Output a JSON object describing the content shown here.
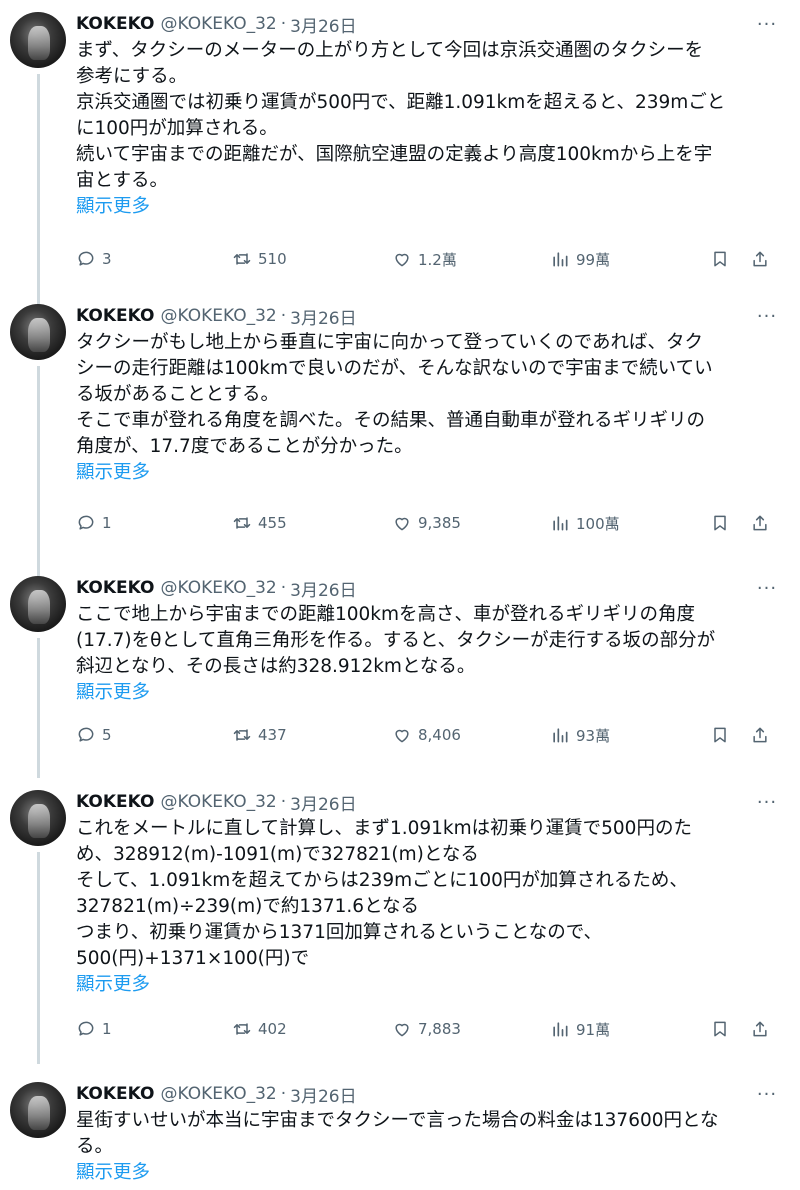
{
  "tweets": [
    {
      "author": {
        "name": "KOKEKO",
        "handle": "@KOKEKO_32",
        "date": "3月26日"
      },
      "lines": [
        "まず、タクシーのメーターの上がり方として今回は京浜交通圏のタクシーを",
        "参考にする。",
        "京浜交通圏では初乗り運賃が500円で、距離1.091kmを超えると、239mごと",
        "に100円が加算される。",
        "続いて宇宙までの距離だが、国際航空連盟の定義より高度100kmから上を宇",
        "宙とする。"
      ],
      "show_more": "顯示更多",
      "stats": {
        "replies": "3",
        "retweets": "510",
        "likes": "1.2萬",
        "views": "99萬"
      }
    },
    {
      "author": {
        "name": "KOKEKO",
        "handle": "@KOKEKO_32",
        "date": "3月26日"
      },
      "lines": [
        "タクシーがもし地上から垂直に宇宙に向かって登っていくのであれば、タク",
        "シーの走行距離は100kmで良いのだが、そんな訳ないので宇宙まで続いてい",
        "る坂があることとする。",
        "そこで車が登れる角度を調べた。その結果、普通自動車が登れるギリギリの",
        "角度が、17.7度であることが分かった。"
      ],
      "show_more": "顯示更多",
      "stats": {
        "replies": "1",
        "retweets": "455",
        "likes": "9,385",
        "views": "100萬"
      }
    },
    {
      "author": {
        "name": "KOKEKO",
        "handle": "@KOKEKO_32",
        "date": "3月26日"
      },
      "lines": [
        "ここで地上から宇宙までの距離100kmを高さ、車が登れるギリギリの角度",
        "(17.7)をθとして直角三角形を作る。すると、タクシーが走行する坂の部分が",
        "斜辺となり、その長さは約328.912kmとなる。"
      ],
      "show_more": "顯示更多",
      "stats": {
        "replies": "5",
        "retweets": "437",
        "likes": "8,406",
        "views": "93萬"
      }
    },
    {
      "author": {
        "name": "KOKEKO",
        "handle": "@KOKEKO_32",
        "date": "3月26日"
      },
      "lines": [
        "これをメートルに直して計算し、まず1.091kmは初乗り運賃で500円のた",
        "め、328912(m)-1091(m)で327821(m)となる",
        "そして、1.091kmを超えてからは239mごとに100円が加算されるため、",
        "327821(m)÷239(m)で約1371.6となる",
        "つまり、初乗り運賃から1371回加算されるということなので、",
        "500(円)+1371×100(円)で"
      ],
      "show_more": "顯示更多",
      "stats": {
        "replies": "1",
        "retweets": "402",
        "likes": "7,883",
        "views": "91萬"
      }
    },
    {
      "author": {
        "name": "KOKEKO",
        "handle": "@KOKEKO_32",
        "date": "3月26日"
      },
      "lines": [
        "星街すいせいが本当に宇宙までタクシーで言った場合の料金は137600円とな",
        "る。"
      ],
      "show_more": "顯示更多"
    }
  ],
  "colors": {
    "text": "#0f1419",
    "muted": "#536471",
    "link": "#1d9bf0",
    "thread_line": "#cfd9de"
  },
  "icons": [
    "reply-icon",
    "retweet-icon",
    "like-icon",
    "views-icon",
    "bookmark-icon",
    "share-icon",
    "more-icon"
  ]
}
